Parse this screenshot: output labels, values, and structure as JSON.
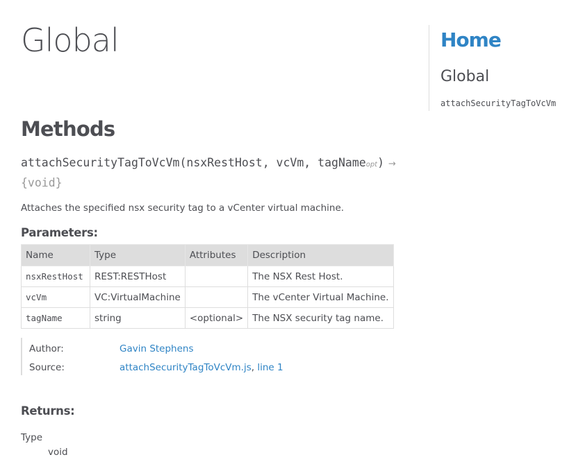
{
  "page": {
    "title": "Global"
  },
  "methods": {
    "heading": "Methods",
    "signature": {
      "name": "attachSecurityTagToVcVm",
      "params_text": "(nsxRestHost, vcVm, tagName",
      "opt_marker": "opt",
      "close": ")",
      "arrow": "→",
      "return_type": "{void}"
    },
    "description": "Attaches the specified nsx security tag to a vCenter virtual machine.",
    "parameters": {
      "heading": "Parameters:",
      "columns": [
        "Name",
        "Type",
        "Attributes",
        "Description"
      ],
      "rows": [
        {
          "name": "nsxRestHost",
          "type": "REST:RESTHost",
          "attributes": "",
          "description": "The NSX Rest Host."
        },
        {
          "name": "vcVm",
          "type": "VC:VirtualMachine",
          "attributes": "",
          "description": "The vCenter Virtual Machine."
        },
        {
          "name": "tagName",
          "type": "string",
          "attributes": "<optional>",
          "description": "The NSX security tag name."
        }
      ]
    },
    "details": {
      "author_label": "Author:",
      "author": "Gavin Stephens",
      "source_label": "Source:",
      "source_file": "attachSecurityTagToVcVm.js",
      "source_sep": ", ",
      "source_line": "line 1"
    },
    "returns": {
      "heading": "Returns:",
      "type_label": "Type",
      "type_value": "void"
    }
  },
  "nav": {
    "home": "Home",
    "section": "Global",
    "items": [
      "attachSecurityTagToVcVm"
    ]
  },
  "colors": {
    "link": "#2f84c5",
    "text": "#4d4e53",
    "table_header": "#dddddd"
  }
}
